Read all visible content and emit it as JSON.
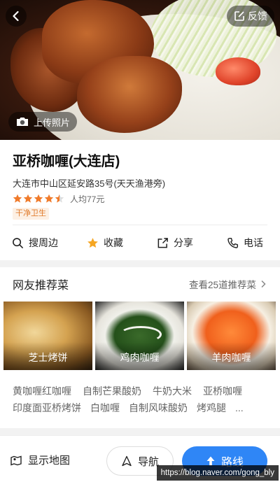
{
  "hero": {
    "feedback_label": "反馈",
    "upload_label": "上传照片"
  },
  "restaurant": {
    "name": "亚桥咖喱(大连店)",
    "address": "大连市中山区延安路35号(天天渔港旁)",
    "rating": 4.5,
    "rating_max": 5,
    "per_capita": "人均77元",
    "tag": "干净卫生"
  },
  "actions": [
    {
      "label": "搜周边",
      "icon": "search-icon"
    },
    {
      "label": "收藏",
      "icon": "star-icon"
    },
    {
      "label": "分享",
      "icon": "share-icon"
    },
    {
      "label": "电话",
      "icon": "phone-icon"
    }
  ],
  "recommend": {
    "title": "网友推荐菜",
    "more_label": "查看25道推荐菜",
    "dishes": [
      {
        "label": "芝士烤饼"
      },
      {
        "label": "鸡肉咖喱"
      },
      {
        "label": "羊肉咖喱"
      }
    ],
    "more_dishes_row1": [
      "黄咖喱红咖喱",
      "自制芒果酸奶",
      "牛奶大米",
      "亚桥咖喱"
    ],
    "more_dishes_row2": [
      "印度面亚桥烤饼",
      "白咖喱",
      "自制风味酸奶",
      "烤鸡腿",
      "..."
    ]
  },
  "bottom": {
    "show_map_label": "显示地图",
    "navigate_label": "导航",
    "route_label": "路线"
  },
  "watermark": "https://blog.naver.com/gong_bly",
  "colors": {
    "accent": "#2f86f6",
    "star": "#f07a2a",
    "tag_text": "#e07a2a",
    "tag_bg": "#fdf0e4"
  }
}
